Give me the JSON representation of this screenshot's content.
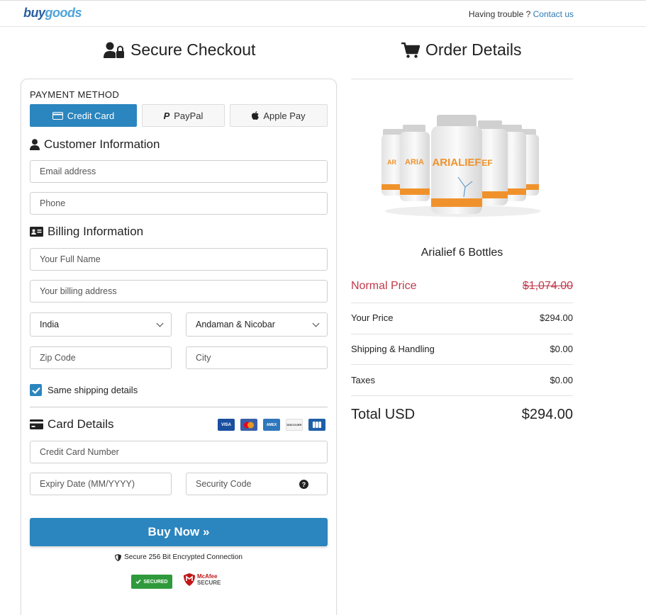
{
  "header": {
    "logo_part1": "buy",
    "logo_part2": "goods",
    "trouble_text": "Having trouble ? ",
    "contact_link": "Contact us"
  },
  "checkout": {
    "title": "Secure Checkout",
    "payment_method_label": "PAYMENT METHOD",
    "payment_methods": [
      {
        "label": "Credit Card",
        "active": true
      },
      {
        "label": "PayPal",
        "active": false
      },
      {
        "label": "Apple Pay",
        "active": false
      }
    ],
    "customer_title": "Customer Information",
    "email_placeholder": "Email address",
    "phone_placeholder": "Phone",
    "billing_title": "Billing Information",
    "fullname_placeholder": "Your Full Name",
    "address_placeholder": "Your billing address",
    "country_value": "India",
    "state_value": "Andaman & Nicobar",
    "zip_placeholder": "Zip Code",
    "city_placeholder": "City",
    "same_shipping_label": "Same shipping details",
    "same_shipping_checked": true,
    "card_title": "Card Details",
    "card_brands": [
      "VISA",
      "MC",
      "AMEX",
      "DISCOVER",
      "JCB"
    ],
    "card_number_placeholder": "Credit Card Number",
    "expiry_placeholder": "Expiry Date (MM/YYYY)",
    "security_placeholder": "Security Code",
    "buy_button": "Buy Now »",
    "secure_text": "Secure 256 Bit Encrypted Connection",
    "badge_secured": "SECURED",
    "badge_mcafee_1": "McAfee",
    "badge_mcafee_2": "SECURE"
  },
  "order": {
    "title": "Order Details",
    "product_name": "Arialief 6 Bottles",
    "product_brand_text": "ARIALIEF",
    "normal_price_label": "Normal Price",
    "normal_price": "$1,074.00",
    "your_price_label": "Your Price",
    "your_price": "$294.00",
    "shipping_label": "Shipping & Handling",
    "shipping": "$0.00",
    "taxes_label": "Taxes",
    "taxes": "$0.00",
    "total_label": "Total USD",
    "total": "$294.00"
  },
  "colors": {
    "accent": "#2b85be",
    "normal_price": "#c0394b",
    "secured_badge": "#2f9a3c"
  }
}
